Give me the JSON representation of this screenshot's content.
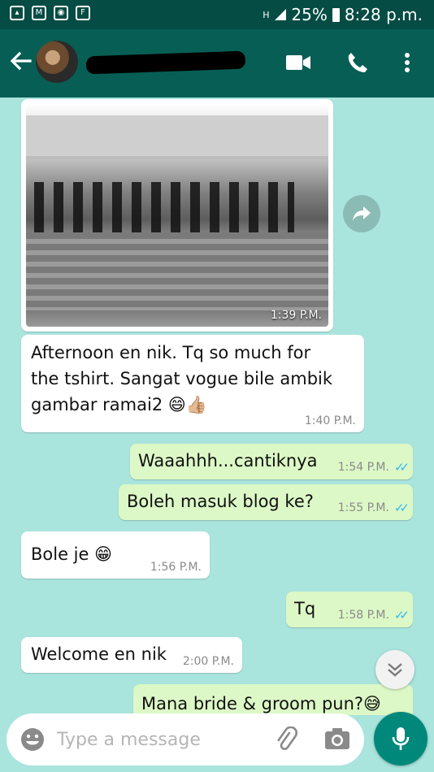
{
  "status_bar": {
    "network": "H",
    "battery": "25%",
    "time": "8:28 p.m."
  },
  "header": {
    "contact_name": "",
    "icons": [
      "back-arrow-icon",
      "avatar",
      "video-call-icon",
      "phone-icon",
      "more-vert-icon"
    ]
  },
  "messages": [
    {
      "type": "image",
      "direction": "in",
      "time": "1:39 P.M."
    },
    {
      "type": "text",
      "direction": "in",
      "lines": [
        "Afternoon en nik. Tq so much for",
        "the tshirt. Sangat vogue bile ambik",
        "gambar ramai2 😄👍🏼"
      ],
      "time": "1:40 P.M."
    },
    {
      "type": "text",
      "direction": "out",
      "text": "Waaahhh...cantiknya",
      "time": "1:54 P.M.",
      "ticks": "✓✓"
    },
    {
      "type": "text",
      "direction": "out",
      "text": "Boleh masuk blog ke?",
      "time": "1:55 P.M.",
      "ticks": "✓✓"
    },
    {
      "type": "text",
      "direction": "in",
      "text": "Bole je 😁",
      "time": "1:56 P.M."
    },
    {
      "type": "text",
      "direction": "out",
      "text": "Tq",
      "time": "1:58 P.M.",
      "ticks": "✓✓"
    },
    {
      "type": "text",
      "direction": "in",
      "text": "Welcome en nik",
      "time": "2:00 P.M."
    },
    {
      "type": "text",
      "direction": "out",
      "text": "Mana bride & groom pun?😅",
      "time": ""
    }
  ],
  "composer": {
    "placeholder": "Type a message"
  },
  "colors": {
    "header": "#075e54",
    "status": "#054c44",
    "chat_bg": "#a9e4dd",
    "outgoing": "#dcf8c6",
    "incoming": "#ffffff",
    "ticks": "#34b7f1",
    "mic": "#00897b"
  }
}
